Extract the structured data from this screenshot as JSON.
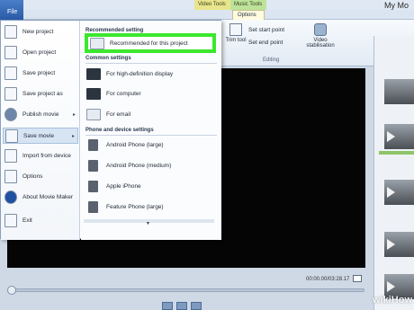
{
  "ribbon": {
    "file_tab": "File",
    "context_tabs": [
      "Video Tools",
      "Music Tools"
    ],
    "app_title": "My Mo",
    "options_tab": "Options",
    "trim_tool": "Trim tool",
    "set_start_point": "Set start point",
    "set_end_point": "Set end point",
    "video_stabilisation": "Video stabilisation",
    "group_editing": "Editing"
  },
  "file_menu": {
    "left_items": [
      {
        "label": "New project",
        "icon": "new-project-icon"
      },
      {
        "label": "Open project",
        "icon": "open-project-icon"
      },
      {
        "label": "Save project",
        "icon": "save-project-icon"
      },
      {
        "label": "Save project as",
        "icon": "save-project-as-icon"
      },
      {
        "label": "Publish movie",
        "icon": "publish-movie-icon",
        "submenu": true
      },
      {
        "label": "Save movie",
        "icon": "save-movie-icon",
        "submenu": true,
        "active": true
      },
      {
        "label": "Import from device",
        "icon": "import-device-icon"
      },
      {
        "label": "Options",
        "icon": "options-icon"
      },
      {
        "label": "About Movie Maker",
        "icon": "info-icon"
      },
      {
        "label": "Exit",
        "icon": "exit-icon"
      }
    ],
    "right": {
      "section_recommended": "Recommended setting",
      "recommended": "Recommended for this project",
      "section_common": "Common settings",
      "common": [
        "For high-definition display",
        "For computer",
        "For email"
      ],
      "section_phone": "Phone and device settings",
      "phone": [
        "Android Phone (large)",
        "Android Phone (medium)",
        "Apple iPhone",
        "Feature Phone (large)"
      ]
    }
  },
  "player": {
    "timecode": "00:00.00/03:28.17"
  },
  "watermark": "wikiHow",
  "colors": {
    "highlight_border": "#3be82d",
    "file_tab": "#2a5aa6",
    "video_tools": "#e8e58d",
    "music_tools": "#bde39a"
  }
}
